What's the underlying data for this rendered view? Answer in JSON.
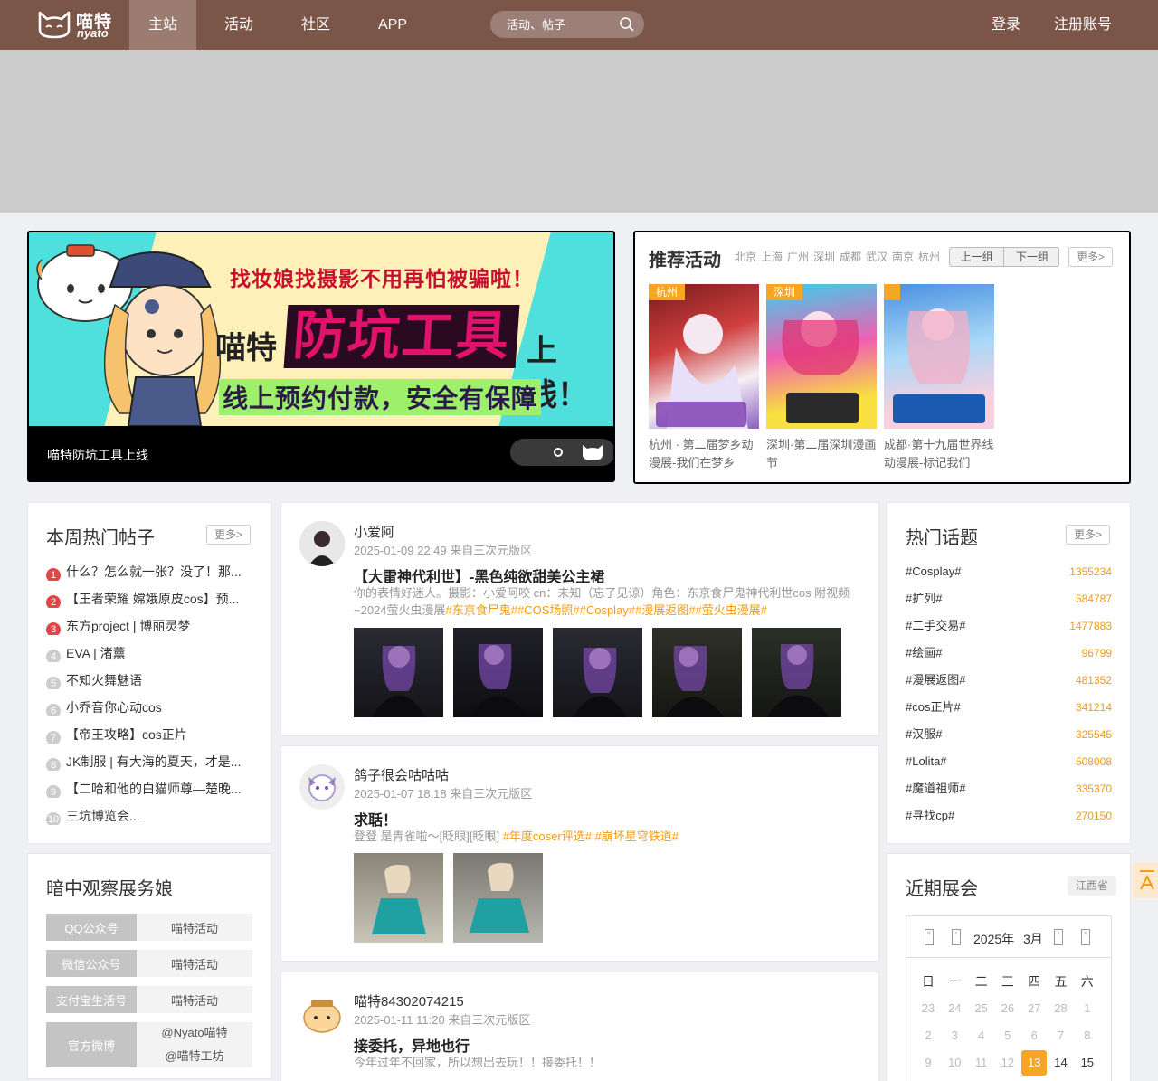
{
  "nav": {
    "logo_cn": "喵特",
    "logo_en": "nyato",
    "items": [
      {
        "label": "主站",
        "active": true
      },
      {
        "label": "活动",
        "active": false
      },
      {
        "label": "社区",
        "active": false
      },
      {
        "label": "APP",
        "active": false
      }
    ],
    "search_placeholder": "活动、帖子",
    "login": "登录",
    "register": "注册账号",
    "bg_color": "#7a5548"
  },
  "hero": {
    "top_line": "找妆娘找摄影不用再怕被骗啦！",
    "mid_prefix": "喵特",
    "mid_highlight": "防坑工具",
    "mid_suffix": "上线！",
    "bottom_line": "线上预约付款，安全有保障",
    "caption": "喵特防坑工具上线"
  },
  "recommended": {
    "title": "推荐活动",
    "cities": [
      "北京",
      "上海",
      "广州",
      "深圳",
      "成都",
      "武汉",
      "南京",
      "杭州"
    ],
    "prev": "上一组",
    "next": "下一组",
    "more": "更多>",
    "cards": [
      {
        "tag": "杭州",
        "name": "杭州 · 第二届梦乡动漫展-我们在梦乡"
      },
      {
        "tag": "深圳",
        "name": "深圳·第二届深圳漫画节"
      },
      {
        "tag": "",
        "name": "成都·第十九届世界线动漫展-标记我们"
      }
    ]
  },
  "hot_posts": {
    "title": "本周热门帖子",
    "more": "更多>",
    "items": [
      "什么？怎么就一张？没了！那...",
      "【王者荣耀 嫦娥原皮cos】预...",
      "东方project | 博丽灵梦",
      "EVA | 渚薰",
      "不知火舞魅语",
      "小乔音你心动cos",
      "【帝王攻略】cos正片",
      "JK制服 | 有大海的夏天，才是...",
      "【二哈和他的白猫师尊—楚晚...",
      "三坑博览会..."
    ]
  },
  "observe": {
    "title": "暗中观察展务娘",
    "rows": [
      {
        "key": "QQ公众号",
        "values": [
          "喵特活动"
        ]
      },
      {
        "key": "微信公众号",
        "values": [
          "喵特活动"
        ]
      },
      {
        "key": "支付宝生活号",
        "values": [
          "喵特活动"
        ]
      },
      {
        "key": "官方微博",
        "values": [
          "@Nyato喵特",
          "@喵特工坊"
        ]
      }
    ]
  },
  "posts": [
    {
      "author": "小爱阿",
      "meta": "2025-01-09 22:49 来自三次元版区",
      "title": "【大雷神代利世】-黑色纯欲甜美公主裙",
      "body": "你的表情好迷人。摄影：小爱阿咬 cn：未知（忘了见谅）角色：东京食尸鬼神代利世cos 附视频~2024萤火虫漫展",
      "tags": "#东京食尸鬼##COS场照##Cosplay##漫展返图##萤火虫漫展#"
    },
    {
      "author": "鸽子很会咕咕咕",
      "meta": "2025-01-07 18:18 来自三次元版区",
      "title": "求聒！",
      "body": "登登 是青雀啦～[眨眼][眨眼]",
      "tags": "#年度coser评选# #崩坏星穹铁道#"
    },
    {
      "author": "喵特84302074215",
      "meta": "2025-01-11 11:20 来自三次元版区",
      "title": "接委托，异地也行",
      "body": "今年过年不回家，所以想出去玩！！接委托！！",
      "tags": ""
    }
  ],
  "topics": {
    "title": "热门话题",
    "more": "更多>",
    "items": [
      {
        "name": "#Cosplay#",
        "count": "1355234"
      },
      {
        "name": "#扩列#",
        "count": "584787"
      },
      {
        "name": "#二手交易#",
        "count": "1477883"
      },
      {
        "name": "#绘画#",
        "count": "96799"
      },
      {
        "name": "#漫展返图#",
        "count": "481352"
      },
      {
        "name": "#cos正片#",
        "count": "341214"
      },
      {
        "name": "#汉服#",
        "count": "325545"
      },
      {
        "name": "#Lolita#",
        "count": "508008"
      },
      {
        "name": "#魔道祖师#",
        "count": "335370"
      },
      {
        "name": "#寻找cp#",
        "count": "270150"
      }
    ]
  },
  "expo": {
    "title": "近期展会",
    "region": "江西省",
    "year": "2025年",
    "month": "3月",
    "weekdays": [
      "日",
      "一",
      "二",
      "三",
      "四",
      "五",
      "六"
    ],
    "prev_days": [
      "23",
      "24",
      "25",
      "26",
      "27",
      "28"
    ],
    "days": [
      "1",
      "2",
      "3",
      "4",
      "5",
      "6",
      "7",
      "8",
      "9",
      "10",
      "11",
      "12",
      "13",
      "14",
      "15"
    ],
    "today": "13"
  }
}
